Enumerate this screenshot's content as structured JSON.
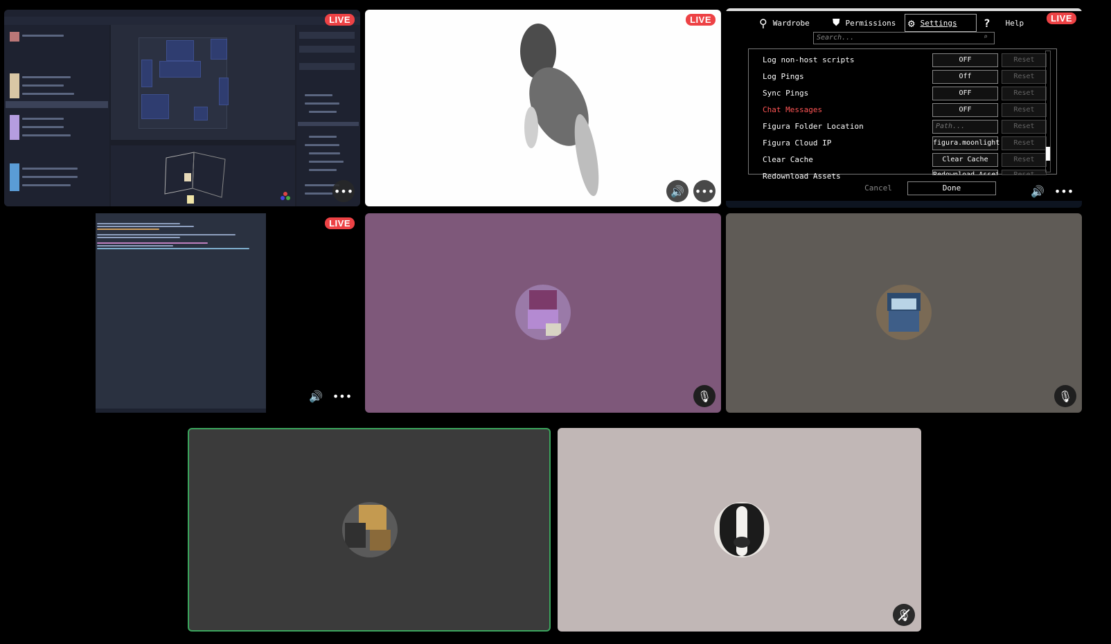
{
  "live_label": "LIVE",
  "icons": {
    "more": "more-icon",
    "volume": "speaker-icon",
    "mic_with_status": "mic-icon",
    "mic_muted": "mic-muted-icon"
  },
  "colors": {
    "live_badge": "#ED4245",
    "speaking_ring": "#3BA55D",
    "tile_purple": "#7E587A",
    "tile_gray_brown": "#5F5B56",
    "tile_dark": "#3B3B3B",
    "tile_light": "#C1B7B6"
  },
  "settings_window": {
    "tabs": [
      {
        "label": "Wardrobe"
      },
      {
        "label": "Permissions"
      },
      {
        "label": "Settings"
      },
      {
        "label": "Help"
      }
    ],
    "search_placeholder": "Search...",
    "rows": [
      {
        "label": "Log non-host scripts",
        "value": "OFF",
        "reset": "Reset"
      },
      {
        "label": "Log Pings",
        "value": "Off",
        "reset": "Reset"
      },
      {
        "label": "Sync Pings",
        "value": "OFF",
        "reset": "Reset"
      },
      {
        "label": "Chat Messages",
        "value": "OFF",
        "reset": "Reset"
      },
      {
        "label": "Figura Folder Location",
        "value": "Path...",
        "reset": "Reset"
      },
      {
        "label": "Figura Cloud IP",
        "value": "figura.moonlight",
        "reset": "Reset"
      },
      {
        "label": "Clear Cache",
        "value": "Clear Cache",
        "reset": "Reset"
      },
      {
        "label": "Redownload Assets",
        "value": "Redownload Assets",
        "reset": "Reset"
      }
    ],
    "cancel_label": "Cancel",
    "done_label": "Done"
  }
}
